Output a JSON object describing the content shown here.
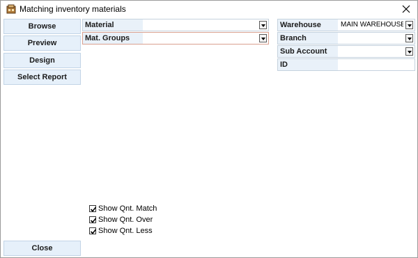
{
  "window": {
    "title": "Matching inventory materials"
  },
  "left_buttons": {
    "browse": "Browse",
    "preview": "Preview",
    "design": "Design",
    "select_report": "Select Report",
    "close": "Close"
  },
  "filters": {
    "material": {
      "label": "Material",
      "value": ""
    },
    "mat_groups": {
      "label": "Mat. Groups",
      "value": ""
    }
  },
  "right_filters": {
    "warehouse": {
      "label": "Warehouse",
      "value": "MAIN WAREHOUSE"
    },
    "branch": {
      "label": "Branch",
      "value": ""
    },
    "sub_account": {
      "label": "Sub Account",
      "value": ""
    },
    "id": {
      "label": "ID",
      "value": ""
    }
  },
  "options": [
    {
      "label": "Show Qnt. Match",
      "checked": true
    },
    {
      "label": "Show Qnt. Over",
      "checked": true
    },
    {
      "label": "Show Qnt. Less",
      "checked": true
    }
  ]
}
